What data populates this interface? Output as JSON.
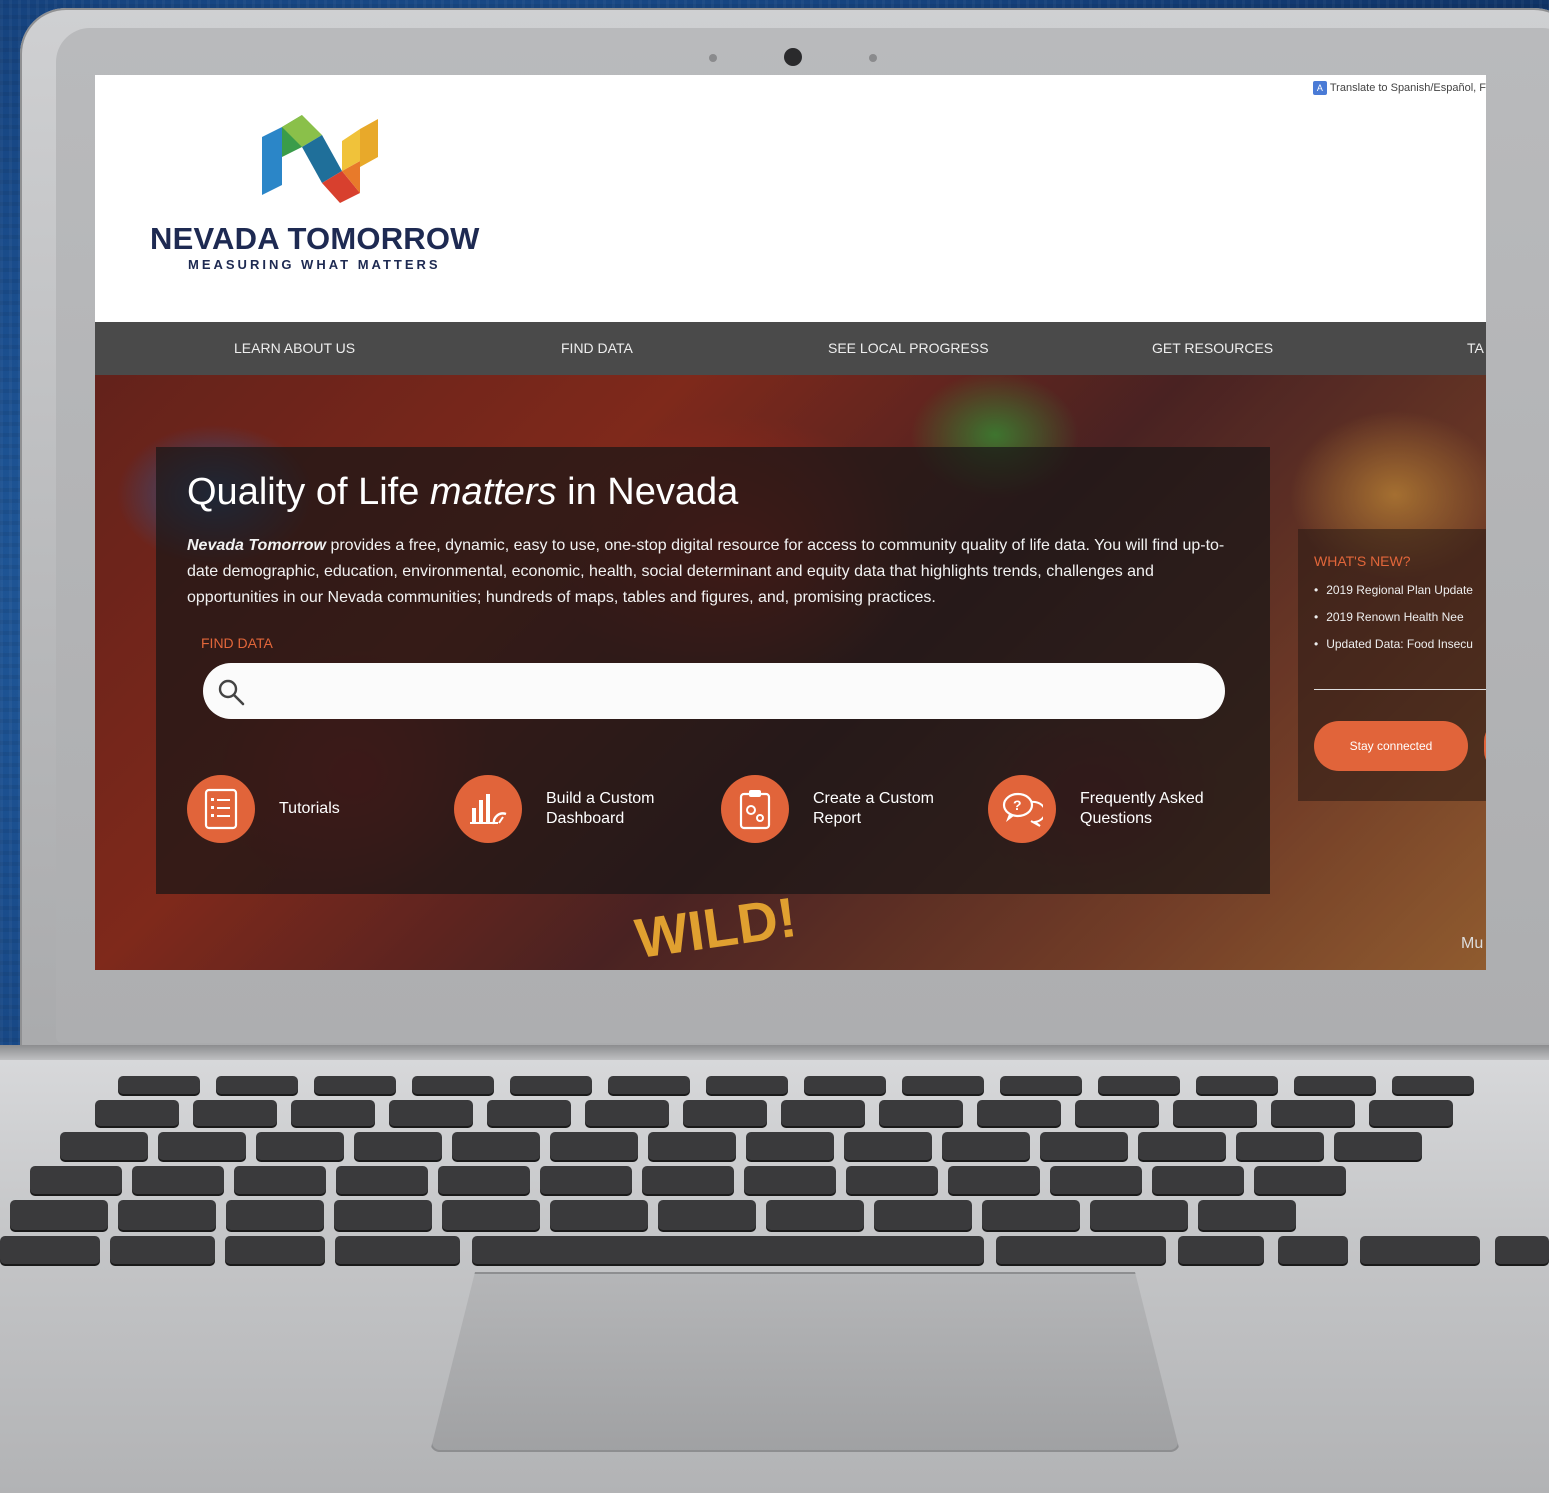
{
  "translate": {
    "text": "Translate to Spanish/Español, F",
    "icon": "google-translate-icon"
  },
  "logo": {
    "title": "NEVADA TOMORROW",
    "subtitle": "MEASURING WHAT MATTERS"
  },
  "nav": {
    "items": [
      {
        "label": "LEARN ABOUT US"
      },
      {
        "label": "FIND DATA"
      },
      {
        "label": "SEE LOCAL PROGRESS"
      },
      {
        "label": "GET RESOURCES"
      },
      {
        "label": "TA"
      }
    ]
  },
  "hero": {
    "title_pre": "Quality of Life ",
    "title_em": "matters",
    "title_post": " in Nevada",
    "desc_em": "Nevada Tomorrow",
    "desc": " provides a free, dynamic, easy to use, one-stop digital resource for access to community quality of life data. You will find up-to-date demographic, education, environmental, economic, health, social determinant and equity data that highlights trends, challenges and opportunities in our Nevada communities; hundreds of maps, tables and figures, and, promising practices.",
    "find_label": "FIND DATA",
    "search_placeholder": "",
    "mural_text": "WILD!",
    "corner_text": "Mu"
  },
  "quick_links": [
    {
      "label": "Tutorials",
      "icon": "checklist-icon"
    },
    {
      "label": "Build a Custom\nDashboard",
      "icon": "dashboard-chart-icon"
    },
    {
      "label": "Create a Custom\nReport",
      "icon": "clipboard-gear-icon"
    },
    {
      "label": "Frequently Asked\nQuestions",
      "icon": "question-chat-icon"
    }
  ],
  "news": {
    "heading": "WHAT'S NEW?",
    "items": [
      {
        "label": "2019 Regional Plan Update"
      },
      {
        "label": "2019 Renown Health Nee"
      },
      {
        "label": "Updated Data: Food Insecu"
      }
    ],
    "stay_label": "Stay connected"
  },
  "colors": {
    "accent": "#e1643a",
    "nav": "#4a4a4a",
    "brand": "#1e2a52"
  }
}
